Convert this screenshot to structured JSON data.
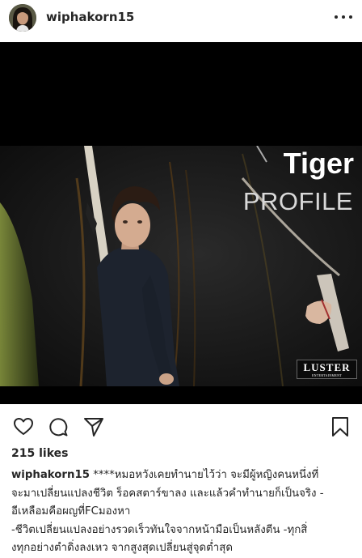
{
  "post": {
    "username": "wiphakorn15",
    "image": {
      "title_line1": "Tiger",
      "title_line2": "PROFILE",
      "logo_text": "LUSTER",
      "logo_subtext": "ENTERTAINMENT"
    },
    "icons": {
      "more": "more-options-icon",
      "like": "heart-icon",
      "comment": "comment-icon",
      "share": "share-icon",
      "save": "bookmark-icon"
    },
    "likes": "215 likes",
    "caption": {
      "username": "wiphakorn15",
      "line1": "****หมอหวังเคยทำนายไว้ว่า จะมีผู้หญิงคนหนึ่งที่",
      "line2": "จะมาเปลี่ยนแปลงชีวิต ร็อคสตาร์ขาลง และแล้วคำทำนายก็เป็นจริง -",
      "line3": "อีเหลือมคือผญที่FCมองหา",
      "line4": "-ชีวิตเปลี่ยนแปลงอย่างรวดเร็วทันใจจากหน้ามือเป็นหลังตีน -ทุกสิ่",
      "line5": "งทุกอย่างตำดิ่งลงเหว จากสูงสุดเปลี่ยนสู่จุดต่ำสุด"
    }
  }
}
